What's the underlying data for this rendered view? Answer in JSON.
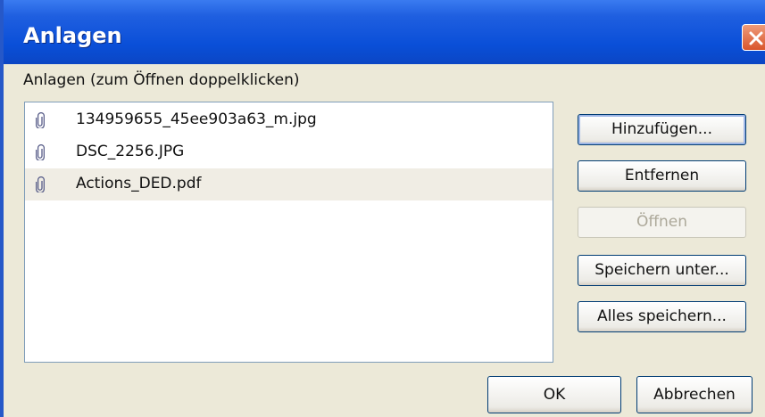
{
  "window": {
    "title": "Anlagen"
  },
  "subtitle": "Anlagen (zum Öffnen doppelklicken)",
  "attachments": [
    {
      "name": "134959655_45ee903a63_m.jpg",
      "icon": "paperclip-icon",
      "selected": false
    },
    {
      "name": "DSC_2256.JPG",
      "icon": "paperclip-icon",
      "selected": false
    },
    {
      "name": "Actions_DED.pdf",
      "icon": "paperclip-icon",
      "selected": true
    }
  ],
  "buttons": {
    "add": "Hinzufügen...",
    "remove": "Entfernen",
    "open": "Öffnen",
    "save_as": "Speichern unter...",
    "save_all": "Alles speichern...",
    "ok": "OK",
    "cancel": "Abbrechen"
  },
  "colors": {
    "titlebar": "#0a4fd8",
    "dialog_bg": "#ece9d8",
    "selection": "#f0ede4",
    "close": "#d9552c"
  }
}
